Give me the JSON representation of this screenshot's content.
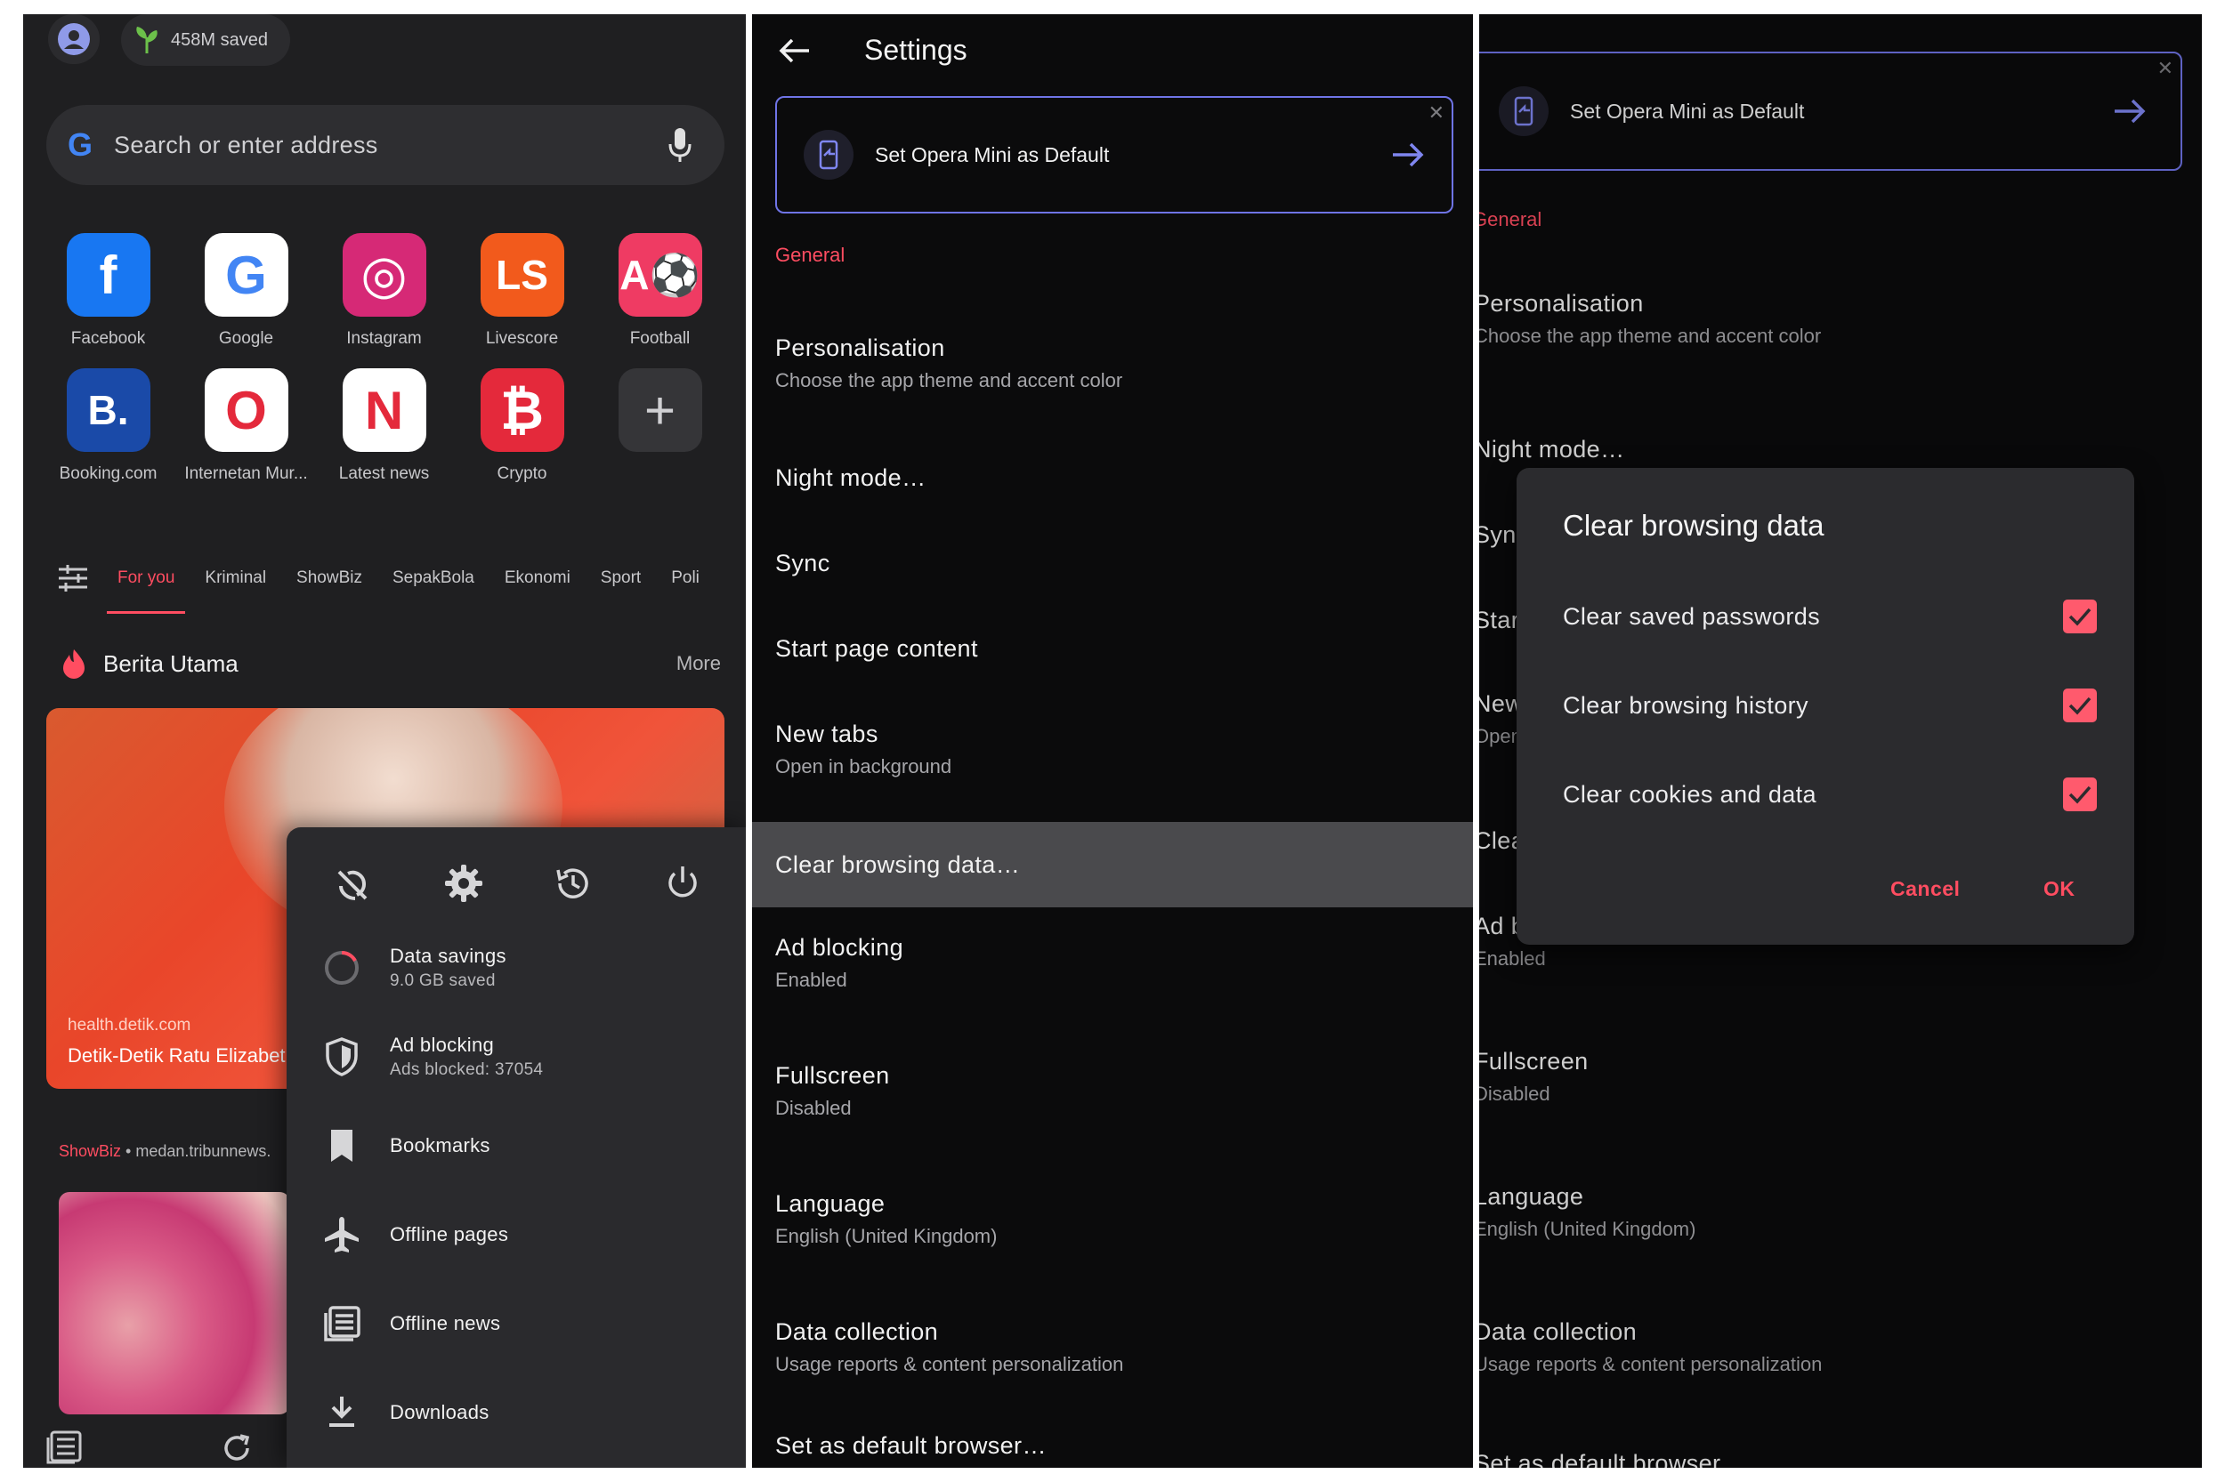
{
  "home": {
    "saved_chip": "458M saved",
    "search_placeholder": "Search or enter address",
    "speed_dial": [
      {
        "label": "Facebook",
        "glyph": "f",
        "color": "#1877f2"
      },
      {
        "label": "Google",
        "glyph": "G",
        "color": "#ffffff"
      },
      {
        "label": "Instagram",
        "glyph": "◎",
        "color": "#d62976"
      },
      {
        "label": "Livescore",
        "glyph": "LS",
        "color": "#f25a1c"
      },
      {
        "label": "Football",
        "glyph": "A⚽",
        "color": "#ef3b63"
      },
      {
        "label": "Booking.com",
        "glyph": "B.",
        "color": "#1a4aa8"
      },
      {
        "label": "Internetan Mur...",
        "glyph": "O",
        "color": "#ffffff"
      },
      {
        "label": "Latest news",
        "glyph": "N",
        "color": "#ffffff"
      },
      {
        "label": "Crypto",
        "glyph": "₿",
        "color": "#e4293b"
      },
      {
        "label": "",
        "glyph": "+",
        "color": "#353538"
      }
    ],
    "news_tabs": [
      "For you",
      "Kriminal",
      "ShowBiz",
      "SepakBola",
      "Ekonomi",
      "Sport",
      "Poli"
    ],
    "section_title": "Berita Utama",
    "section_more": "More",
    "hero_source": "health.detik.com",
    "hero_headline": "Detik-Detik Ratu Elizabeth",
    "showbiz_category": "ShowBiz",
    "showbiz_source": " • medan.tribunnews.",
    "menu": {
      "items": [
        {
          "label": "Data savings",
          "sub": "9.0 GB saved",
          "icon": "data-savings-icon"
        },
        {
          "label": "Ad blocking",
          "sub": "Ads blocked: 37054",
          "icon": "shield-icon"
        },
        {
          "label": "Bookmarks",
          "sub": "",
          "icon": "bookmark-icon"
        },
        {
          "label": "Offline pages",
          "sub": "",
          "icon": "airplane-icon"
        },
        {
          "label": "Offline news",
          "sub": "",
          "icon": "news-icon"
        },
        {
          "label": "Downloads",
          "sub": "",
          "icon": "download-icon"
        }
      ]
    }
  },
  "settings": {
    "title": "Settings",
    "default_card": "Set Opera Mini as Default",
    "section_general": "General",
    "items": [
      {
        "label": "Personalisation",
        "sub": "Choose the app theme and accent color"
      },
      {
        "label": "Night mode…",
        "sub": ""
      },
      {
        "label": "Sync",
        "sub": ""
      },
      {
        "label": "Start page content",
        "sub": ""
      },
      {
        "label": "New tabs",
        "sub": "Open in background"
      },
      {
        "label": "Clear browsing data…",
        "sub": ""
      },
      {
        "label": "Ad blocking",
        "sub": "Enabled"
      },
      {
        "label": "Fullscreen",
        "sub": "Disabled"
      },
      {
        "label": "Language",
        "sub": "English (United Kingdom)"
      },
      {
        "label": "Data collection",
        "sub": "Usage reports & content personalization"
      },
      {
        "label": "Set as default browser…",
        "sub": ""
      }
    ]
  },
  "dialog_panel": {
    "default_card": "Set Opera Mini as Default",
    "section_general": "General",
    "bg_items": [
      {
        "label": "Personalisation",
        "sub": "Choose the app theme and accent color"
      },
      {
        "label": "Night mode…",
        "sub": ""
      },
      {
        "label": "Sync",
        "sub": ""
      },
      {
        "label": "Start",
        "sub": ""
      },
      {
        "label": "New",
        "sub": "Open"
      },
      {
        "label": "Clea",
        "sub": ""
      },
      {
        "label": "Ad b",
        "sub": "Enabled"
      },
      {
        "label": "Fullscreen",
        "sub": "Disabled"
      },
      {
        "label": "Language",
        "sub": "English (United Kingdom)"
      },
      {
        "label": "Data collection",
        "sub": "Usage reports & content personalization"
      },
      {
        "label": "Set as default browser",
        "sub": ""
      }
    ],
    "dialog": {
      "title": "Clear browsing data",
      "options": [
        {
          "label": "Clear saved passwords",
          "checked": true
        },
        {
          "label": "Clear browsing history",
          "checked": true
        },
        {
          "label": "Clear cookies and data",
          "checked": true
        }
      ],
      "cancel": "Cancel",
      "ok": "OK"
    }
  },
  "colors": {
    "accent": "#ff4d61",
    "card_border": "#6f74e6",
    "checkbox": "#ff5a6d"
  }
}
